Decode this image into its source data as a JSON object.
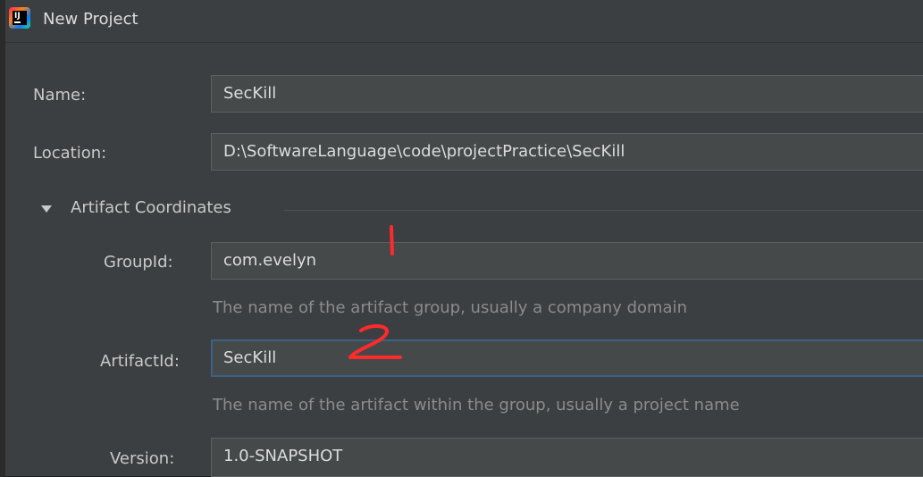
{
  "window": {
    "title": "New Project"
  },
  "form": {
    "name_label": "Name:",
    "name_value": "SecKill",
    "location_label": "Location:",
    "location_value": "D:\\SoftwareLanguage\\code\\projectPractice\\SecKill",
    "section_label": "Artifact Coordinates",
    "groupid_label": "GroupId:",
    "groupid_value": "com.evelyn",
    "groupid_hint": "The name of the artifact group, usually a company domain",
    "artifactid_label": "ArtifactId:",
    "artifactid_value": "SecKill",
    "artifactid_hint": "The name of the artifact within the group, usually a project name",
    "version_label": "Version:",
    "version_value": "1.0-SNAPSHOT"
  },
  "annotations": {
    "mark_1": "1",
    "mark_2": "2",
    "color": "#ff2a2a"
  }
}
